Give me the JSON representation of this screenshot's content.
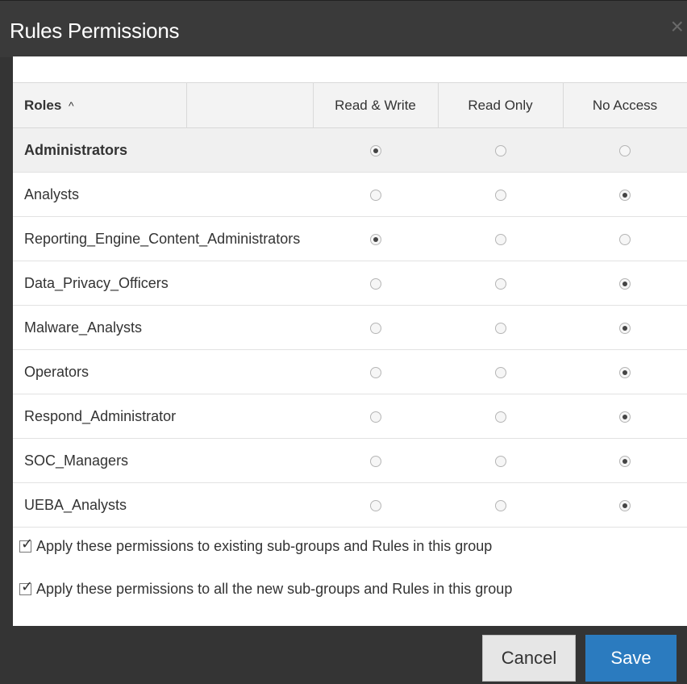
{
  "dialog": {
    "title": "Rules Permissions",
    "close_label": "×"
  },
  "table": {
    "headers": {
      "roles": "Roles",
      "sort_indicator": "^",
      "extra": "",
      "read_write": "Read & Write",
      "read_only": "Read Only",
      "no_access": "No Access"
    },
    "rows": [
      {
        "role": "Administrators",
        "access": "read_write",
        "selected": true
      },
      {
        "role": "Analysts",
        "access": "no_access",
        "selected": false
      },
      {
        "role": "Reporting_Engine_Content_Administrators",
        "access": "read_write",
        "selected": false
      },
      {
        "role": "Data_Privacy_Officers",
        "access": "no_access",
        "selected": false
      },
      {
        "role": "Malware_Analysts",
        "access": "no_access",
        "selected": false
      },
      {
        "role": "Operators",
        "access": "no_access",
        "selected": false
      },
      {
        "role": "Respond_Administrator",
        "access": "no_access",
        "selected": false
      },
      {
        "role": "SOC_Managers",
        "access": "no_access",
        "selected": false
      },
      {
        "role": "UEBA_Analysts",
        "access": "no_access",
        "selected": false
      }
    ]
  },
  "options": {
    "apply_existing": {
      "label": "Apply these permissions to existing sub-groups and Rules in this group",
      "checked": true
    },
    "apply_new": {
      "label": "Apply these permissions to all the new sub-groups and Rules in this group",
      "checked": true
    }
  },
  "buttons": {
    "cancel": "Cancel",
    "save": "Save"
  },
  "colors": {
    "title_bar": "#3a3a3a",
    "save_button": "#2b7bbf",
    "selected_row": "#f0f0f0"
  }
}
